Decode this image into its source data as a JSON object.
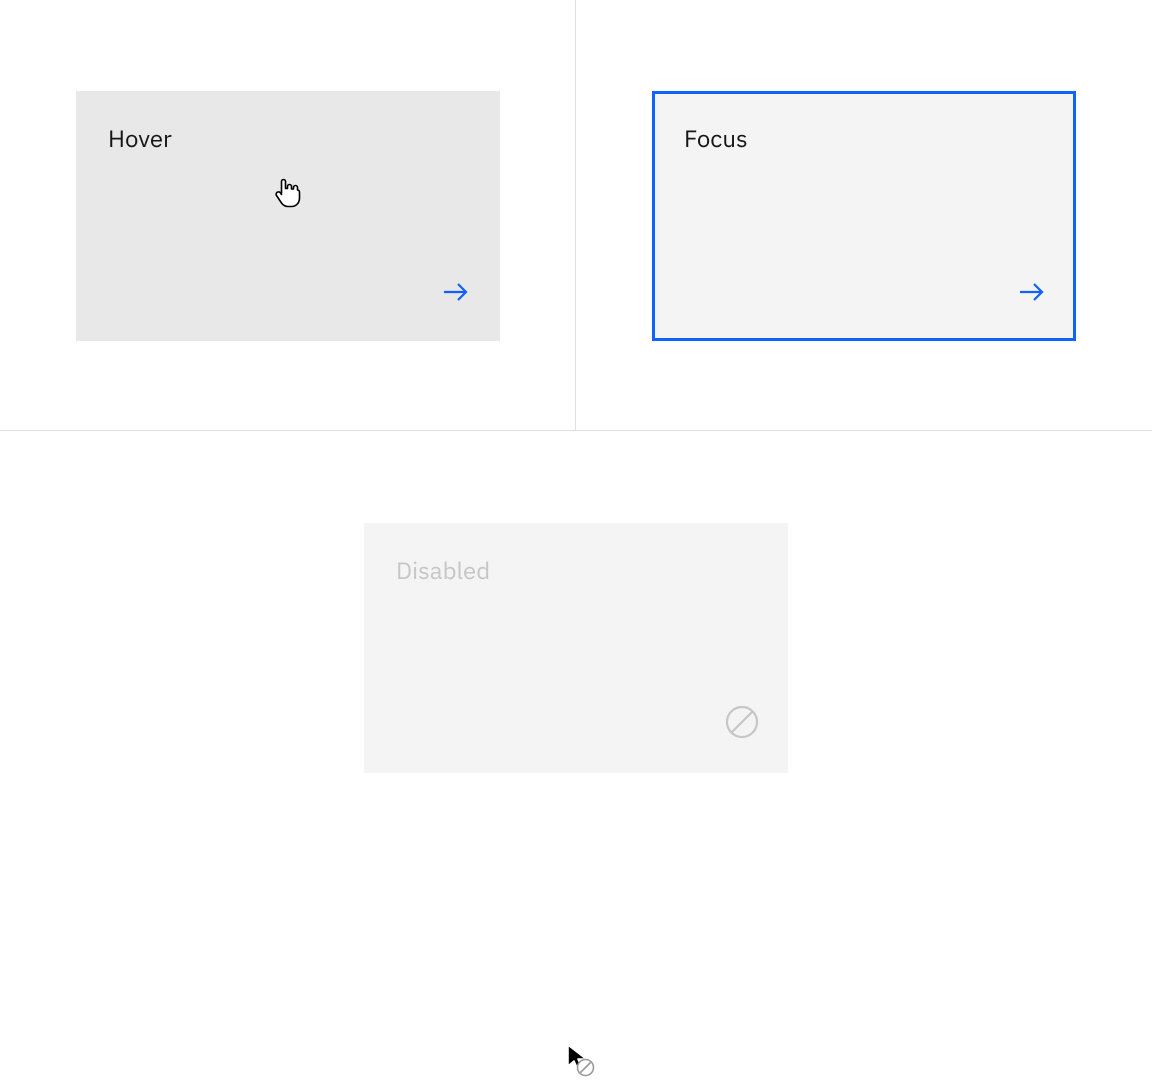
{
  "tiles": {
    "hover": {
      "label": "Hover",
      "bg": "#e8e8e8",
      "text_color": "#161616",
      "icon": "arrow-right",
      "icon_color": "#0f62fe"
    },
    "focus": {
      "label": "Focus",
      "bg": "#f4f4f4",
      "text_color": "#161616",
      "outline_color": "#0f62fe",
      "icon": "arrow-right",
      "icon_color": "#0f62fe"
    },
    "disabled": {
      "label": "Disabled",
      "bg": "#f4f4f4",
      "text_color": "#c6c6c6",
      "icon": "no-symbol",
      "icon_color": "#c6c6c6"
    }
  },
  "cursors": {
    "hover": "pointer-hand",
    "disabled": "not-allowed"
  }
}
